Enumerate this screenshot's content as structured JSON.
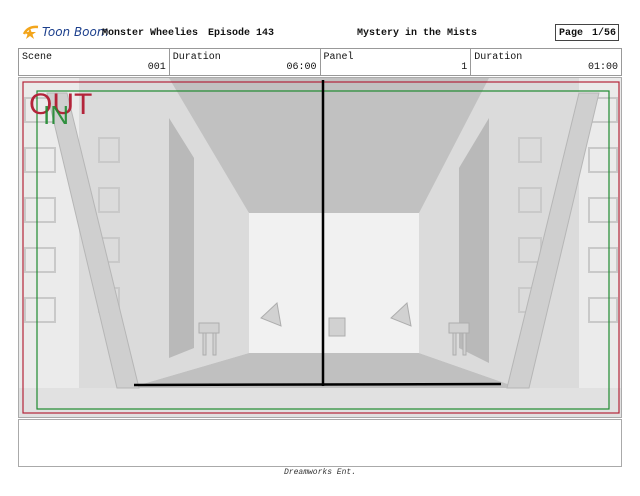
{
  "header": {
    "logo_text": "Toon Boom",
    "show_title": "Monster Wheelies",
    "episode": "Episode 143",
    "episode_title": "Mystery in the Mists",
    "page_label": "Page",
    "page_value": "1/56"
  },
  "info": {
    "scene_label": "Scene",
    "scene_value": "001",
    "duration_label": "Duration",
    "duration_value": "06:00",
    "panel_label": "Panel",
    "panel_value": "1",
    "panel_duration_label": "Duration",
    "panel_duration_value": "01:00"
  },
  "frame": {
    "out_label": "OUT",
    "in_label": "IN"
  },
  "footer": {
    "studio": "Dreamworks Ent."
  }
}
